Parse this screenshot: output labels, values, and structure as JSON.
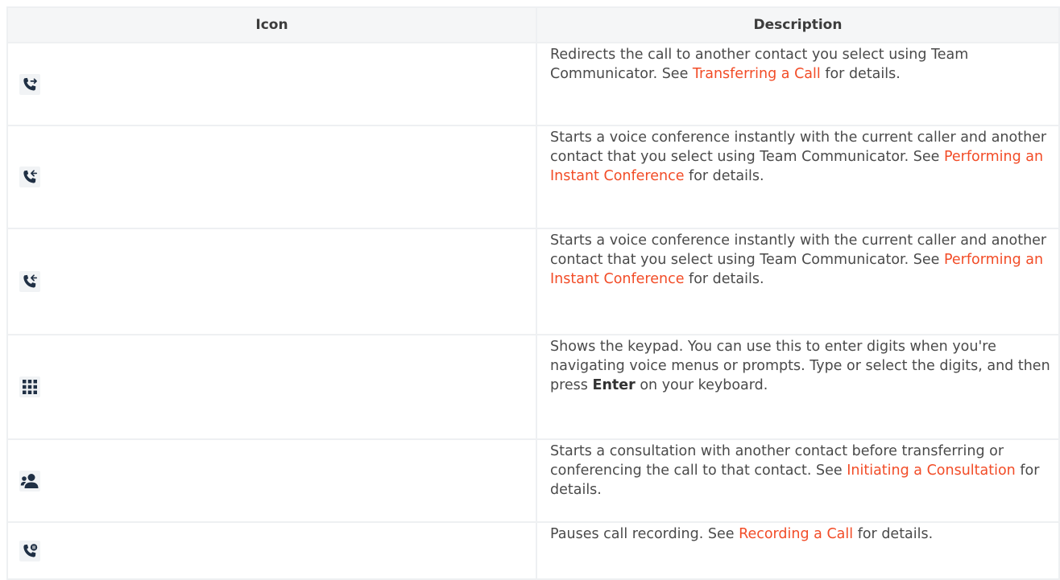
{
  "table": {
    "headers": {
      "icon": "Icon",
      "description": "Description"
    },
    "rows": [
      {
        "icon_name": "transfer-call-icon",
        "text1": "Redirects the call to another contact you select using Team Communicator. See ",
        "link": "Transferring a Call",
        "text2": " for details."
      },
      {
        "icon_name": "instant-conference-icon",
        "text1": "Starts a voice conference instantly with the current caller and another contact that you select using Team Communicator. See ",
        "link": "Performing an Instant Conference",
        "text2": " for details."
      },
      {
        "icon_name": "instant-conference-icon",
        "text1": "Starts a voice conference instantly with the current caller and another contact that you select using Team Communicator. See ",
        "link": "Performing an Instant Conference",
        "text2": " for details."
      },
      {
        "icon_name": "keypad-icon",
        "text1": "Shows the keypad. You can use this to enter digits when you're navigating voice menus or prompts. Type or select the digits, and then press ",
        "bold": "Enter",
        "text2": " on your keyboard."
      },
      {
        "icon_name": "consultation-icon",
        "text1": "Starts a consultation with another contact before transferring or conferencing the call to that contact. See ",
        "link": "Initiating a Consultation",
        "text2": " for details."
      },
      {
        "icon_name": "pause-recording-icon",
        "text1": "Pauses call recording. See ",
        "link": "Recording a Call",
        "text2": " for details."
      }
    ]
  },
  "colors": {
    "link": "#f24c27",
    "text": "#4a4a4a",
    "header_bg": "#f5f6f7",
    "border": "#eef0f2"
  }
}
